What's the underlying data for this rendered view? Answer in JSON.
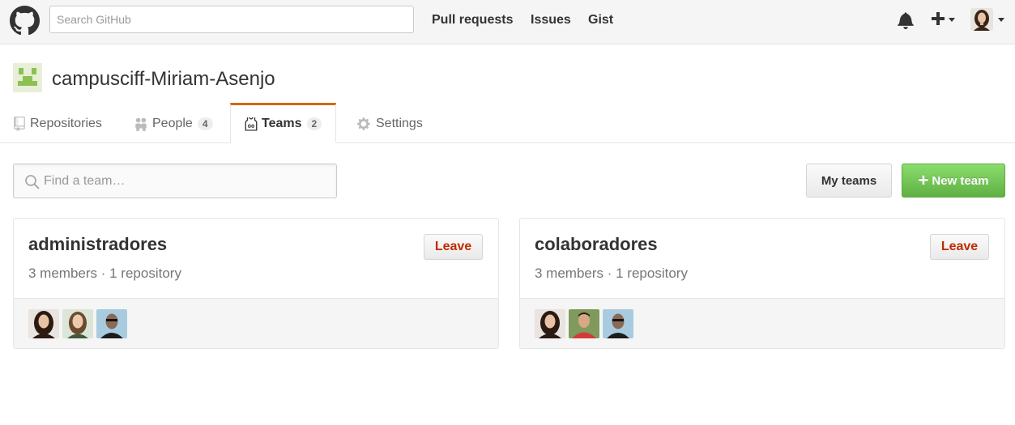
{
  "header": {
    "search_placeholder": "Search GitHub",
    "nav": [
      "Pull requests",
      "Issues",
      "Gist"
    ]
  },
  "org": {
    "name": "campusciff-Miriam-Asenjo"
  },
  "tabs": [
    {
      "label": "Repositories",
      "icon": "repo-icon"
    },
    {
      "label": "People",
      "count": "4",
      "icon": "people-icon"
    },
    {
      "label": "Teams",
      "count": "2",
      "icon": "jersey-icon",
      "selected": true
    },
    {
      "label": "Settings",
      "icon": "gear-icon"
    }
  ],
  "toolbar": {
    "find_placeholder": "Find a team…",
    "my_teams": "My teams",
    "new_team": "New team"
  },
  "teams": [
    {
      "name": "administradores",
      "meta": "3 members · 1 repository",
      "leave": "Leave",
      "members": [
        "woman-dark-hair",
        "woman-light-hair",
        "man-glasses"
      ]
    },
    {
      "name": "colaboradores",
      "meta": "3 members · 1 repository",
      "leave": "Leave",
      "members": [
        "woman-dark-hair",
        "man-red-shirt",
        "man-glasses"
      ]
    }
  ],
  "colors": {
    "accent_tab": "#d26911",
    "new_team_green": "#60b044",
    "leave_red": "#bd2c00"
  }
}
